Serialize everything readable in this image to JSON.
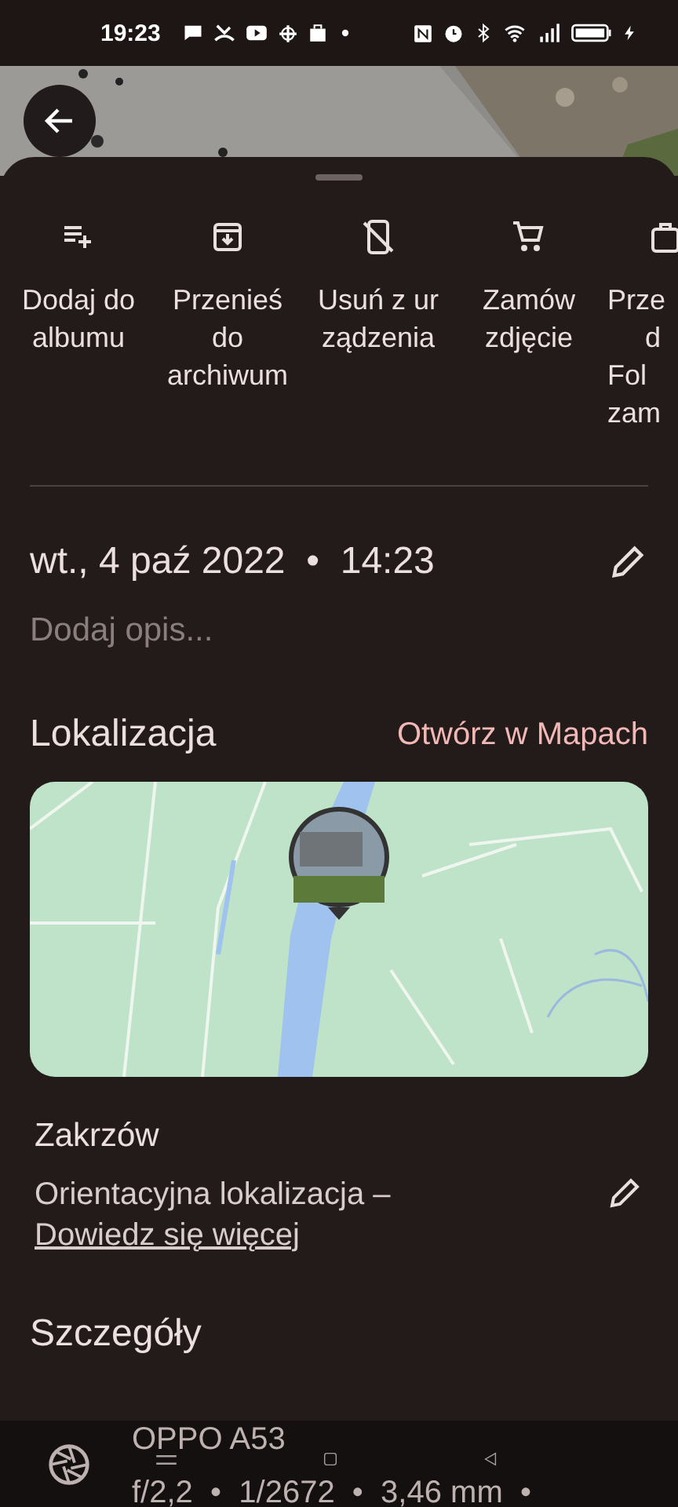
{
  "status_bar": {
    "time": "19:23"
  },
  "actions": [
    {
      "lines": [
        "Dodaj do",
        "albumu"
      ]
    },
    {
      "lines": [
        "Przenieś",
        "do",
        "archiwum"
      ]
    },
    {
      "lines": [
        "Usuń z ur",
        "ządzenia"
      ]
    },
    {
      "lines": [
        "Zamów",
        "zdjęcie"
      ]
    },
    {
      "lines": [
        "Prze",
        "d",
        "Fol",
        "zam"
      ]
    }
  ],
  "date": "wt., 4 paź 2022  •  14:23",
  "description": {
    "placeholder": "Dodaj opis..."
  },
  "location": {
    "heading": "Lokalizacja",
    "open_link": "Otwórz w Mapach",
    "place": "Zakrzów",
    "note": "Orientacyjna lokalizacja – ",
    "learn_more": "Dowiedz się więcej"
  },
  "details": {
    "heading": "Szczegóły",
    "device": "OPPO A53",
    "exif": "f/2,2  •  1/2672  •  3,46 mm  •"
  }
}
